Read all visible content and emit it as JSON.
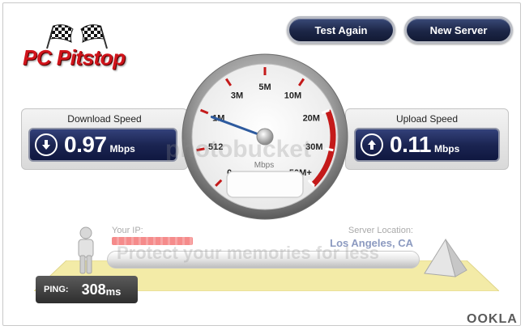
{
  "logo": {
    "text": "PC Pitstop"
  },
  "buttons": {
    "test_again": "Test Again",
    "new_server": "New Server"
  },
  "download": {
    "title": "Download Speed",
    "value": "0.97",
    "unit": "Mbps"
  },
  "upload": {
    "title": "Upload Speed",
    "value": "0.11",
    "unit": "Mbps"
  },
  "gauge": {
    "ticks": [
      "0",
      "512",
      "1M",
      "3M",
      "5M",
      "10M",
      "20M",
      "30M",
      "50M+"
    ],
    "unit": "Mbps",
    "needle_value_mbps": 0.97
  },
  "ip": {
    "label": "Your IP:"
  },
  "server": {
    "label": "Server Location:",
    "value": "Los Angeles, CA"
  },
  "ping": {
    "label": "PING:",
    "value": "308",
    "unit": "ms"
  },
  "brand": {
    "ookla": "OOKLA"
  },
  "watermark": {
    "text1": "photobucket",
    "text2": "Protect your memories for less"
  },
  "colors": {
    "button_navy": "#1c2647",
    "logo_red": "#d0141b",
    "gauge_red": "#c41a1a",
    "server_blue": "#8c9ac0"
  }
}
